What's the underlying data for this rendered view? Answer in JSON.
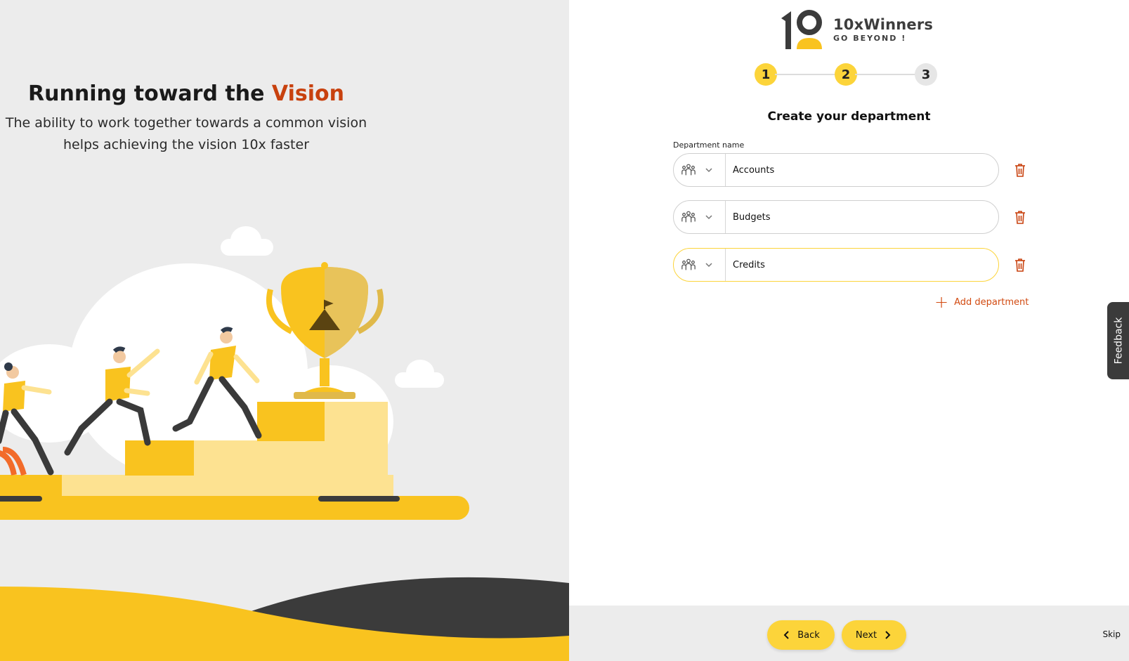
{
  "hero": {
    "title_main": "Running toward the",
    "title_accent": "Vision",
    "subtitle_line1": "The ability to work together towards a common vision",
    "subtitle_line2": "helps achieving the vision 10x faster"
  },
  "brand": {
    "name": "10xWinners",
    "tagline": "GO BEYOND !"
  },
  "stepper": {
    "steps": [
      "1",
      "2",
      "3"
    ],
    "active_count": 2
  },
  "form": {
    "title": "Create your department",
    "field_label": "Department name",
    "departments": [
      {
        "icon": "team-icon",
        "value": "Accounts"
      },
      {
        "icon": "team-icon",
        "value": "Budgets"
      },
      {
        "icon": "team-icon",
        "value": "Credits"
      }
    ],
    "add_label": "Add department"
  },
  "feedback_label": "Feedback",
  "footer": {
    "back_label": "Back",
    "next_label": "Next",
    "skip_label": "Skip"
  },
  "colors": {
    "accent_yellow": "#fcd43a",
    "accent_orange": "#c8410e",
    "dark": "#3b3b3b"
  }
}
